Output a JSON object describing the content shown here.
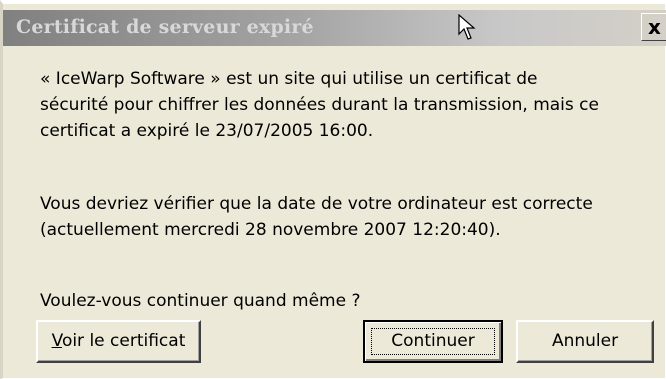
{
  "dialog": {
    "title": "Certificat de serveur expiré",
    "close_glyph": "x",
    "close_icon": "close-icon",
    "cursor_icon": "mouse-pointer-icon"
  },
  "message": {
    "line1": "« IceWarp Software » est un site qui utilise un certificat de",
    "line2": "sécurité pour chiffrer les données durant la transmission, mais ce",
    "line3": "certificat a expiré le 23/07/2005 16:00.",
    "line4": "Vous devriez vérifier que la date de votre ordinateur est correcte",
    "line5": "(actuellement mercredi 28 novembre 2007 12:20:40).",
    "question": "Voulez-vous continuer quand même ?"
  },
  "buttons": {
    "view_certificate_mnemonic": "V",
    "view_certificate_rest": "oir le certificat",
    "continue": "Continuer",
    "cancel": "Annuler"
  },
  "colors": {
    "titlebar_inactive_start": "#808080",
    "titlebar_inactive_end": "#d4d0c8",
    "dialog_background": "#ece9d8"
  }
}
